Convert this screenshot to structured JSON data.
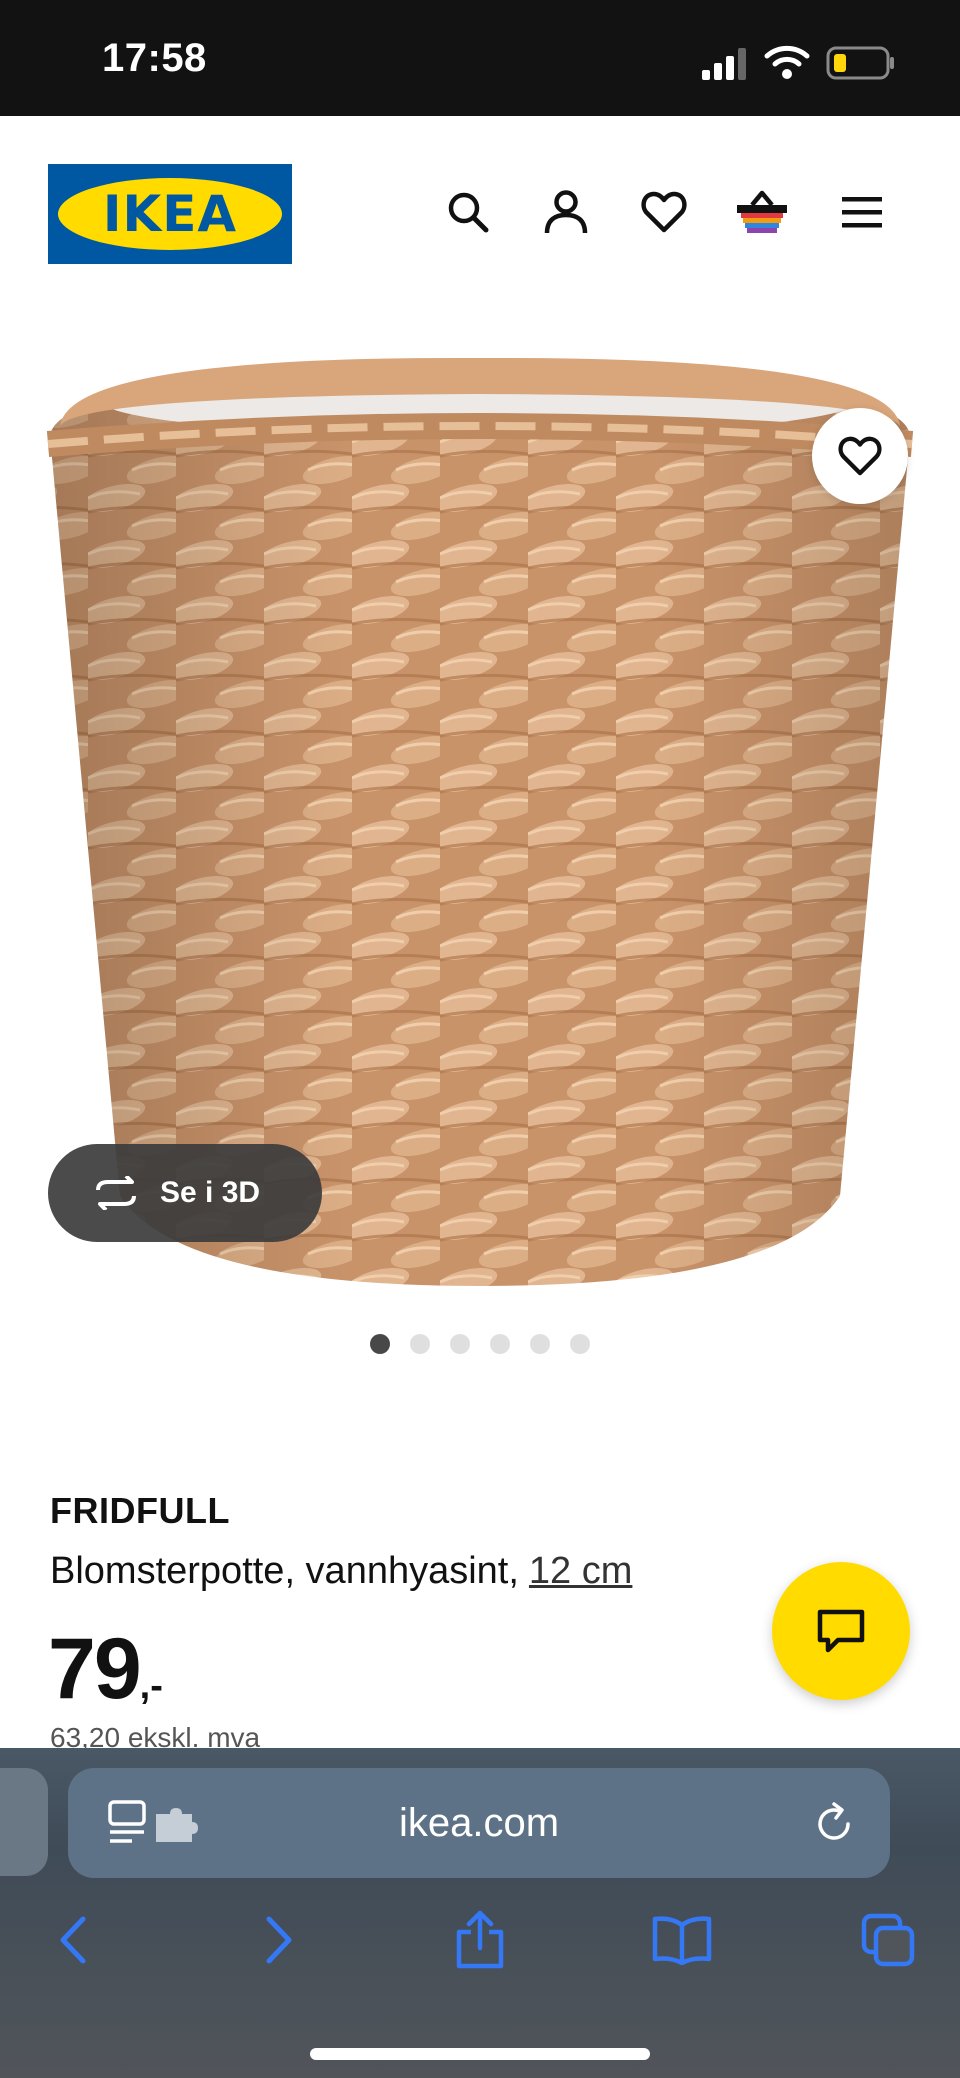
{
  "status_bar": {
    "time": "17:58"
  },
  "header": {
    "logo_text": "IKEA",
    "icons": [
      "search-icon",
      "account-icon",
      "heart-icon",
      "basket-icon",
      "menu-icon"
    ]
  },
  "gallery": {
    "view3d_label": "Se i 3D",
    "dot_count": 6,
    "active_dot": 1
  },
  "product": {
    "name": "FRIDFULL",
    "description": "Blomsterpotte, vannhyasint,",
    "size": "12 cm",
    "price": "79",
    "price_suffix": ",-",
    "price_ex_vat": "63,20 ekskl. mva"
  },
  "browser": {
    "url": "ikea.com",
    "nav": [
      "back-icon",
      "forward-icon",
      "share-icon",
      "bookmarks-icon",
      "tabs-icon"
    ]
  },
  "colors": {
    "ikea_blue": "#0058a3",
    "ikea_yellow": "#ffdb00"
  }
}
